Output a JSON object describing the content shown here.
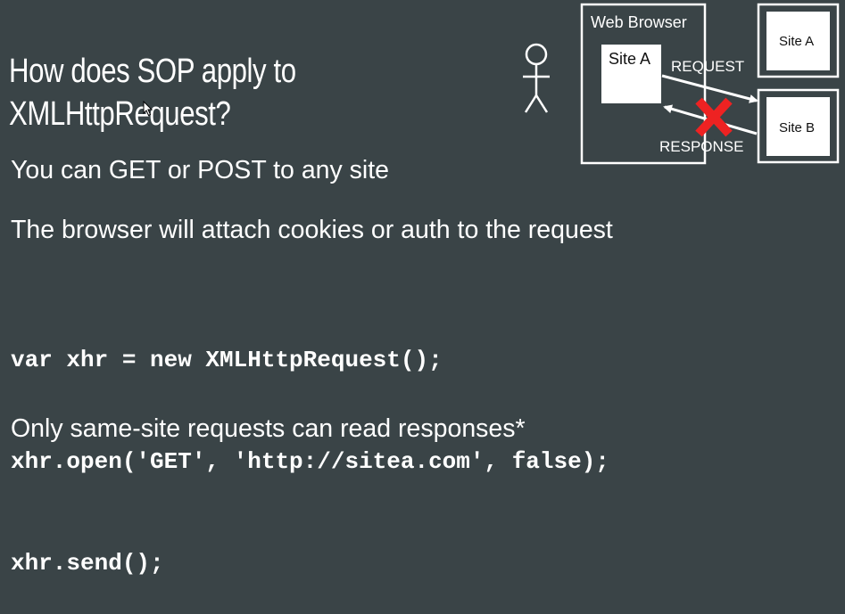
{
  "slide": {
    "title_line1": "How does SOP apply to",
    "title_line2": "XMLHttpRequest?",
    "bullet1": "You can GET or POST to any site",
    "bullet2": "The browser will attach cookies or auth to the request",
    "code_lines": [
      "var xhr = new XMLHttpRequest();",
      "xhr.open('GET', 'http://sitea.com', false);",
      "xhr.send();"
    ],
    "footer": "Only same-site requests can read responses*"
  },
  "diagram": {
    "browser_label": "Web Browser",
    "inner_site": "Site A",
    "outer_site_a": "Site A",
    "outer_site_b": "Site B",
    "request_label": "REQUEST",
    "response_label": "RESPONSE",
    "blocked_color": "#ee2222"
  },
  "colors": {
    "background": "#3a4447",
    "text": "#ffffff"
  }
}
